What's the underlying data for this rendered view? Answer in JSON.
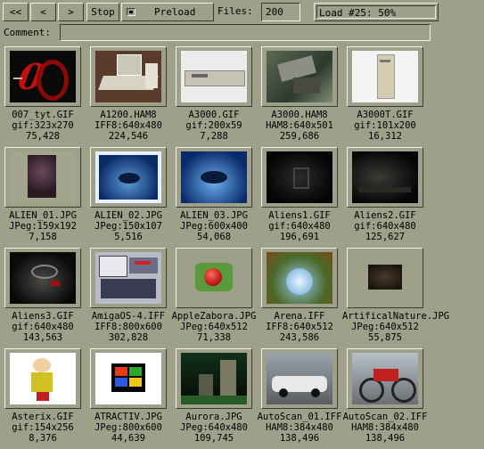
{
  "toolbar": {
    "first_label": "<<",
    "prev_label": "<",
    "next_label": ">",
    "last_label": ">>",
    "stop_label": "Stop",
    "preload_label": "Preload",
    "preload_checked": true,
    "files_label": "Files:",
    "files_value": "200",
    "status": "Load #25: 50%"
  },
  "comment": {
    "label": "Comment:",
    "value": ""
  },
  "items": [
    {
      "name": "007_tyt.GIF",
      "info": "gif:323x270",
      "size": "75,428",
      "thumb": "logo-007"
    },
    {
      "name": "A1200.HAM8",
      "info": "IFF8:640x480",
      "size": "224,546",
      "thumb": "computer-desk"
    },
    {
      "name": "A3000.GIF",
      "info": "gif:200x59",
      "size": "7,288",
      "thumb": "desktop-case"
    },
    {
      "name": "A3000.HAM8",
      "info": "HAM8:640x501",
      "size": "259,686",
      "thumb": "render-scene"
    },
    {
      "name": "A3000T.GIF",
      "info": "gif:101x200",
      "size": "16,312",
      "thumb": "tower-case"
    },
    {
      "name": "ALIEN_01.JPG",
      "info": "JPeg:159x192",
      "size": "7,158",
      "thumb": "alien-face"
    },
    {
      "name": "ALIEN_02.JPG",
      "info": "JPeg:150x107",
      "size": "5,516",
      "thumb": "alien-blue-framed"
    },
    {
      "name": "ALIEN_03.JPG",
      "info": "JPeg:600x400",
      "size": "54,068",
      "thumb": "alien-blue"
    },
    {
      "name": "Aliens1.GIF",
      "info": "gif:640x480",
      "size": "196,691",
      "thumb": "dark-corridor"
    },
    {
      "name": "Aliens2.GIF",
      "info": "gif:640x480",
      "size": "125,627",
      "thumb": "dark-room"
    },
    {
      "name": "Aliens3.GIF",
      "info": "gif:640x480",
      "size": "143,563",
      "thumb": "dark-hall"
    },
    {
      "name": "AmigaOS-4.IFF",
      "info": "IFF8:800x600",
      "size": "302,828",
      "thumb": "os-screen"
    },
    {
      "name": "AppleZabora.JPG",
      "info": "JPeg:640x512",
      "size": "71,338",
      "thumb": "apple"
    },
    {
      "name": "Arena.IFF",
      "info": "IFF8:640x512",
      "size": "243,586",
      "thumb": "arena"
    },
    {
      "name": "ArtificalNature.JPG",
      "info": "JPeg:640x512",
      "size": "55,875",
      "thumb": "small-dark"
    },
    {
      "name": "Asterix.GIF",
      "info": "gif:154x256",
      "size": "8,376",
      "thumb": "cartoon"
    },
    {
      "name": "ATRACTIV.JPG",
      "info": "JPeg:800x600",
      "size": "44,639",
      "thumb": "windows-logo"
    },
    {
      "name": "Aurora.JPG",
      "info": "JPeg:640x480",
      "size": "109,745",
      "thumb": "statues"
    },
    {
      "name": "AutoScan_01.IFF",
      "info": "HAM8:384x480",
      "size": "138,496",
      "thumb": "race-car"
    },
    {
      "name": "AutoScan_02.IFF",
      "info": "HAM8:384x480",
      "size": "138,496",
      "thumb": "bike"
    }
  ]
}
